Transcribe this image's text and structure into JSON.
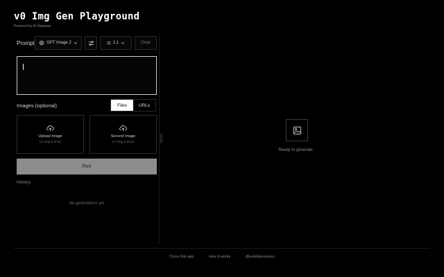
{
  "header": {
    "title": "v0 Img Gen Playground",
    "subtitle": "Powered by AI Gateway"
  },
  "prompt": {
    "label": "Prompt",
    "model_select": "GPT Image 2",
    "aspect_select": "1:1",
    "clear_label": "Clear",
    "value": ""
  },
  "images": {
    "label": "Images (optional)",
    "tabs": [
      {
        "label": "Files",
        "active": true
      },
      {
        "label": "URLs",
        "active": false
      }
    ],
    "uploads": [
      {
        "title": "Upload Image",
        "hint": "(or drag & drop)"
      },
      {
        "title": "Second Image",
        "hint": "(or drag & drop)"
      }
    ]
  },
  "run_label": "Run",
  "history": {
    "label": "History",
    "empty_text": "No generations yet"
  },
  "preview": {
    "status": "Ready to generate"
  },
  "footer": {
    "links": [
      "Clone this app",
      "How it works",
      "@estebansuarez"
    ]
  },
  "colors": {
    "background": "#000000",
    "run_button": "#8c8c8c",
    "active_tab": "#ffffff"
  }
}
